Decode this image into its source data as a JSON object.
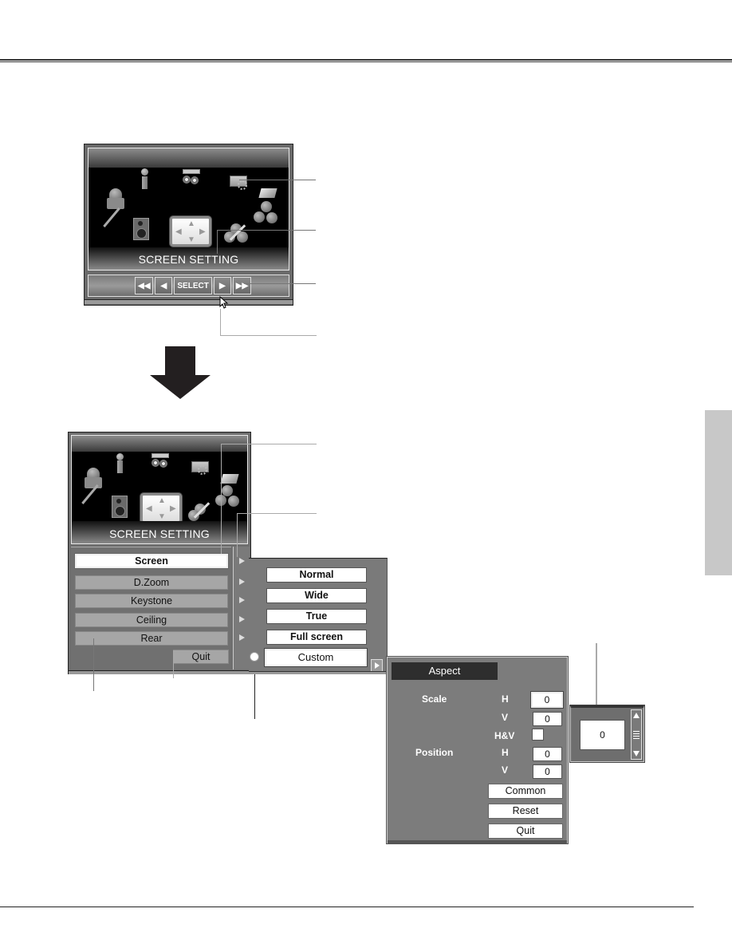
{
  "main_menu": {
    "title": "SCREEN SETTING",
    "icons": [
      "person-wrench-icon",
      "info-icon",
      "projector-icon",
      "screen-gear-icon",
      "laptop-balls-icon",
      "speaker-icon",
      "screen-setting-icon",
      "balls-pencil-icon"
    ],
    "nav_buttons": [
      {
        "name": "first-button",
        "label": "◀◀"
      },
      {
        "name": "prev-button",
        "label": "◀"
      },
      {
        "name": "select-button",
        "label": "SELECT"
      },
      {
        "name": "next-button",
        "label": "▶"
      },
      {
        "name": "last-button",
        "label": "▶▶"
      }
    ]
  },
  "screen_menu": {
    "title": "SCREEN SETTING",
    "items": [
      {
        "label": "Screen",
        "selected": true
      },
      {
        "label": "D.Zoom",
        "selected": false
      },
      {
        "label": "Keystone",
        "selected": false
      },
      {
        "label": "Ceiling",
        "selected": false
      },
      {
        "label": "Rear",
        "selected": false
      }
    ],
    "quit_label": "Quit"
  },
  "screen_options": {
    "items": [
      {
        "label": "Normal"
      },
      {
        "label": "Wide"
      },
      {
        "label": "True"
      },
      {
        "label": "Full screen"
      },
      {
        "label": "Custom"
      }
    ],
    "selected": "Custom"
  },
  "aspect": {
    "title": "Aspect",
    "scale_label": "Scale",
    "position_label": "Position",
    "h_label": "H",
    "v_label": "V",
    "hv_label": "H&V",
    "scale_h": "0",
    "scale_v": "0",
    "position_h": "0",
    "position_v": "0",
    "hv_checked": false,
    "common_label": "Common",
    "reset_label": "Reset",
    "quit_label": "Quit"
  },
  "value_adjuster": {
    "value": "0"
  }
}
